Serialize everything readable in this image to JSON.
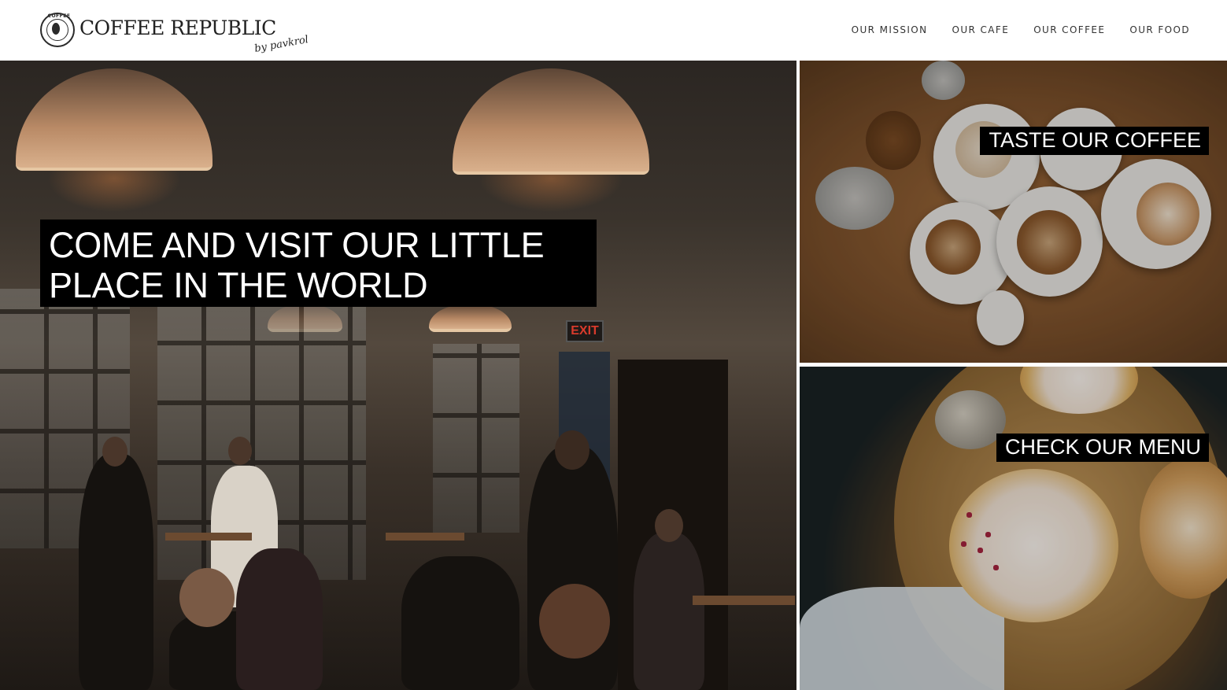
{
  "brand": {
    "name": "COFFEE REPUBLIC",
    "tagline": "by pavkrol",
    "badge_text": "COFFEE"
  },
  "nav": {
    "items": [
      {
        "label": "OUR MISSION"
      },
      {
        "label": "OUR CAFE"
      },
      {
        "label": "OUR COFFEE"
      },
      {
        "label": "OUR FOOD"
      }
    ]
  },
  "hero": {
    "heading_line1": "COME AND VISIT OUR LITTLE",
    "heading_line2": "PLACE IN THE WORLD",
    "exit_sign": "EXIT"
  },
  "tiles": {
    "coffee": {
      "label": "TASTE OUR COFFEE"
    },
    "menu": {
      "label": "CHECK OUR MENU"
    }
  },
  "colors": {
    "caption_bg": "#000000",
    "caption_text": "#ffffff",
    "nav_text": "#333333"
  }
}
